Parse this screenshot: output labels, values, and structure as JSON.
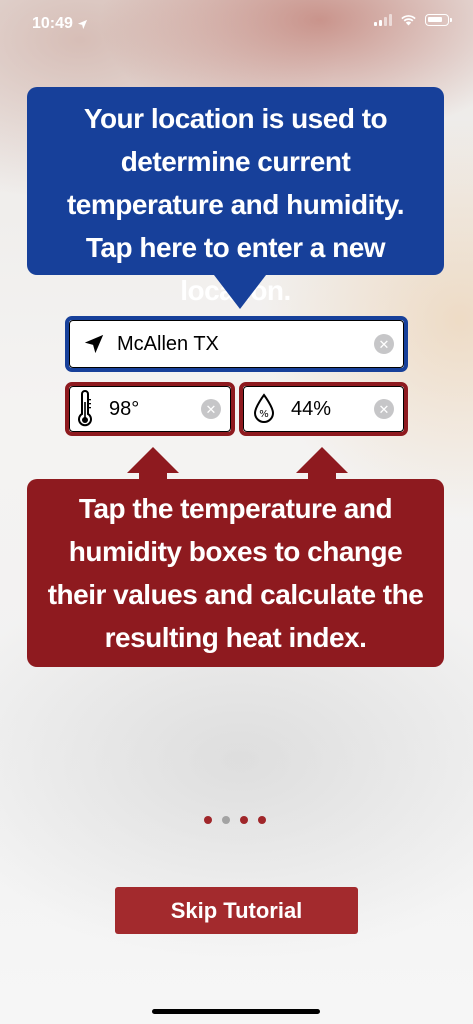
{
  "status_bar": {
    "time": "10:49"
  },
  "location_callout": {
    "text": "Your location is used to determine current temperature and humidity. Tap here to enter a new location."
  },
  "inputs": {
    "location": "McAllen TX",
    "temperature": "98°",
    "humidity": "44%"
  },
  "values_callout": {
    "text": "Tap the temperature and humidity boxes to change their values and calculate the resulting heat index."
  },
  "pager": {
    "total": 4,
    "current": 2
  },
  "skip_button": {
    "label": "Skip Tutorial"
  },
  "colors": {
    "blue": "#17409a",
    "red": "#8e1a1f",
    "button_red": "#a32a2d"
  },
  "icons": {
    "location": "location-arrow-icon",
    "temperature": "thermometer-icon",
    "humidity": "humidity-drop-icon",
    "clear": "clear-icon"
  }
}
